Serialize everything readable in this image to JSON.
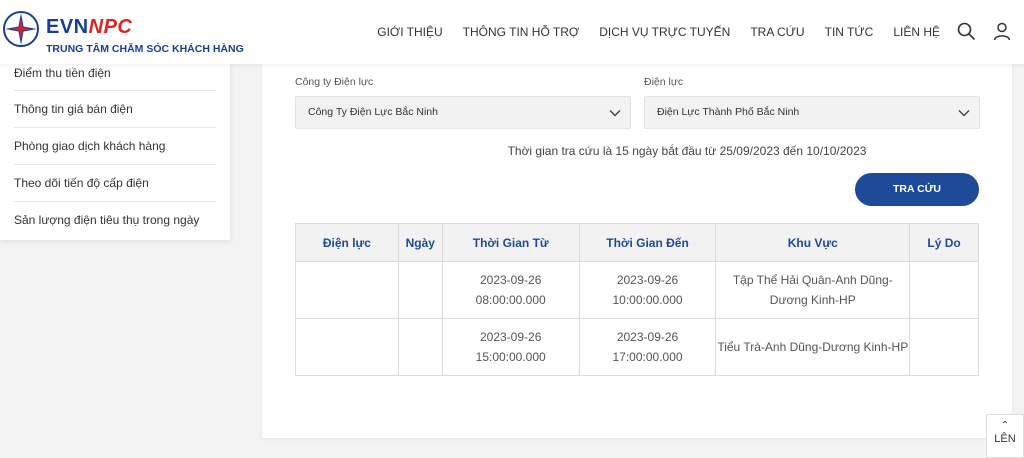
{
  "header": {
    "brand_evn": "EVN",
    "brand_npc": "NPC",
    "subtitle": "TRUNG TÂM CHĂM SÓC KHÁCH HÀNG",
    "nav": [
      "GIỚI THIỆU",
      "THÔNG TIN HỖ TRỢ",
      "DỊCH VỤ TRỰC TUYẾN",
      "TRA CỨU",
      "TIN TỨC",
      "LIÊN HỆ"
    ]
  },
  "sidebar": {
    "items": [
      "Điểm thu tiền điện",
      "Thông tin giá bán điện",
      "Phòng giao dịch khách hàng",
      "Theo dõi tiến độ cấp điện",
      "Sản lượng điện tiêu thụ trong ngày"
    ]
  },
  "form": {
    "company_label": "Công ty Điện lực",
    "company_value": "Công Ty Điện Lực Bắc Ninh",
    "unit_label": "Điện lực",
    "unit_value": "Điện Lực Thành Phố Bắc Ninh",
    "note": "Thời gian tra cứu là 15 ngày bắt đầu từ 25/09/2023 đến 10/10/2023",
    "search_button": "TRA CỨU"
  },
  "table": {
    "headers": [
      "Điện lực",
      "Ngày",
      "Thời Gian Từ",
      "Thời Gian Đến",
      "Khu Vực",
      "Lý Do"
    ],
    "rows": [
      {
        "dien_luc": "",
        "ngay": "",
        "tu_date": "2023-09-26",
        "tu_time": "08:00:00.000",
        "den_date": "2023-09-26",
        "den_time": "10:00:00.000",
        "khu_vuc_1": "Tập Thể Hải Quân-Anh Dũng-",
        "khu_vuc_2": "Dương Kinh-HP",
        "ly_do": ""
      },
      {
        "dien_luc": "",
        "ngay": "",
        "tu_date": "2023-09-26",
        "tu_time": "15:00:00.000",
        "den_date": "2023-09-26",
        "den_time": "17:00:00.000",
        "khu_vuc_1": "Tiểu Trà-Anh Dũng-Dương Kinh-HP",
        "khu_vuc_2": "",
        "ly_do": ""
      }
    ]
  },
  "back_to_top": "LÊN",
  "icons": {
    "logo": "evn-star-logo-icon",
    "search": "search-icon",
    "user": "user-icon",
    "chevron": "chevron-down-icon",
    "up": "arrow-up-icon"
  },
  "colors": {
    "brand_blue": "#1a3f8f",
    "brand_red": "#e02424",
    "button": "#1e4b99"
  }
}
